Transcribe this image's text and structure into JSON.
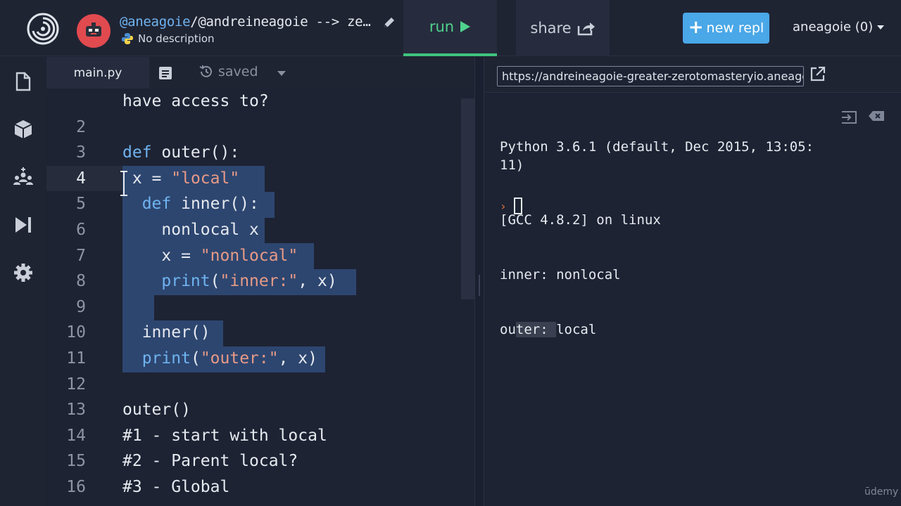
{
  "header": {
    "repl_owner": "@aneagoie",
    "repl_name_rest": "/@andreineagoie --> ze…",
    "description": "No description",
    "run_label": "run",
    "share_label": "share",
    "new_repl_label": "new repl",
    "user_label": "aneagoie (0)"
  },
  "editor": {
    "file_tab": "main.py",
    "save_status": "saved"
  },
  "code_lines": [
    {
      "n": "",
      "text": "have access to?"
    },
    {
      "n": "2",
      "text": ""
    },
    {
      "n": "3",
      "text": "def outer():"
    },
    {
      "n": "4",
      "text": " x = \"local\""
    },
    {
      "n": "5",
      "text": "  def inner():"
    },
    {
      "n": "6",
      "text": "    nonlocal x"
    },
    {
      "n": "7",
      "text": "    x = \"nonlocal\""
    },
    {
      "n": "8",
      "text": "    print(\"inner:\", x)"
    },
    {
      "n": "9",
      "text": ""
    },
    {
      "n": "10",
      "text": "  inner()"
    },
    {
      "n": "11",
      "text": "  print(\"outer:\", x)"
    },
    {
      "n": "12",
      "text": ""
    },
    {
      "n": "13",
      "text": "outer()"
    },
    {
      "n": "14",
      "text": "#1 - start with local"
    },
    {
      "n": "15",
      "text": "#2 - Parent local?"
    },
    {
      "n": "16",
      "text": "#3 - Global"
    }
  ],
  "output": {
    "url": "https://andreineagoie-greater-zerotomasteryio.aneagoie",
    "console_lines": [
      "Python 3.6.1 (default, Dec 2015, 13:05:11)",
      "[GCC 4.8.2] on linux",
      "inner: nonlocal"
    ],
    "last_line_a": "ou",
    "last_line_b": "ter: ",
    "last_line_c": "local",
    "prompt_symbol": "›"
  },
  "watermark": "ūdemy",
  "colors": {
    "accent_run": "#3fc47d",
    "new_repl_bg": "#4aa7e8",
    "selection": "#2d4670",
    "keyword": "#6fb3f0",
    "string": "#e89a86",
    "comment": "#79a872"
  }
}
